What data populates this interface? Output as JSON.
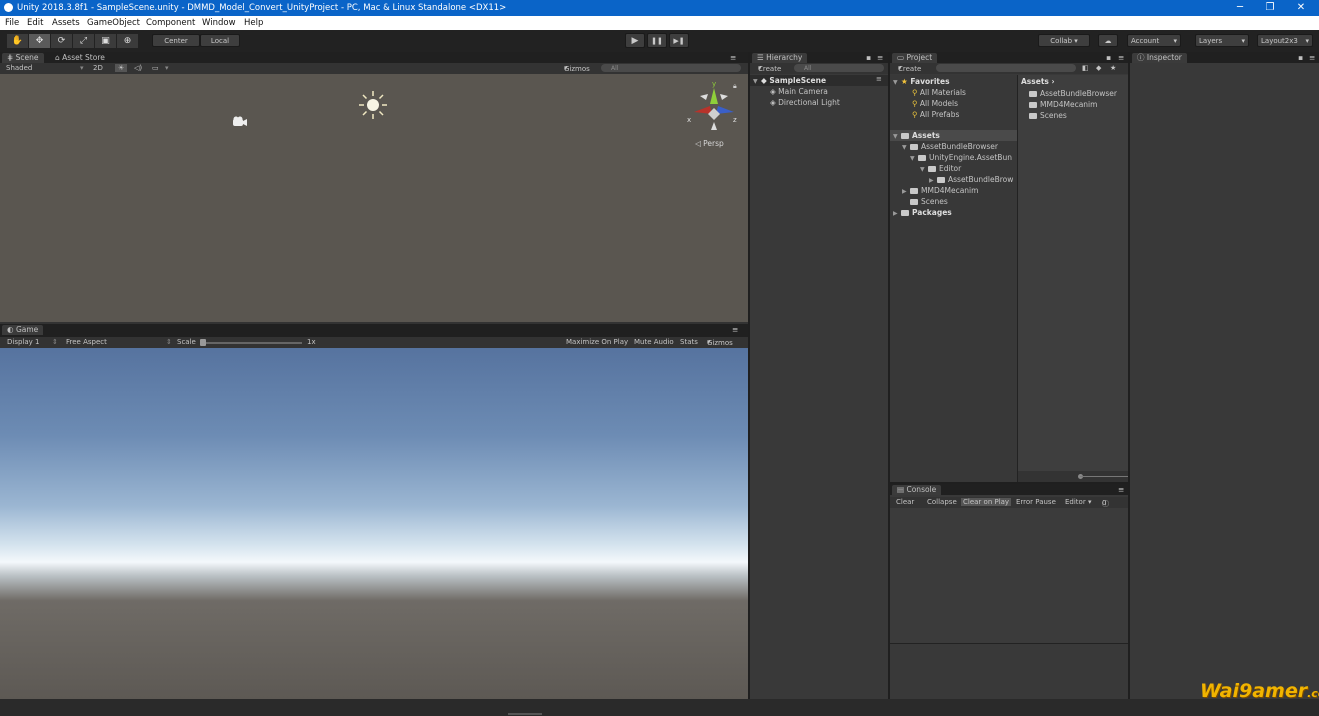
{
  "window": {
    "title": "Unity 2018.3.8f1 - SampleScene.unity - DMMD_Model_Convert_UnityProject - PC, Mac & Linux Standalone <DX11>",
    "controls": [
      "─",
      "❐",
      "✕"
    ]
  },
  "menu": [
    "File",
    "Edit",
    "Assets",
    "GameObject",
    "Component",
    "Window",
    "Help"
  ],
  "toolbar": {
    "tools": [
      "✋",
      "✥",
      "⟳",
      "⤢",
      "▣",
      "⊕"
    ],
    "pivot": "Center",
    "space": "Local",
    "play": "▶",
    "pause": "❚❚",
    "step": "▶❚",
    "collab": "Collab ▾",
    "cloud": "☁",
    "account": "Account",
    "layers": "Layers",
    "layout": "Layout2x3"
  },
  "scene": {
    "tabs": [
      "Scene",
      "Asset Store"
    ],
    "shading": "Shaded",
    "mode_2d": "2D",
    "gizmos": "Gizmos",
    "search_placeholder": "All",
    "persp": "Persp",
    "gizmo_axes": {
      "y": "y",
      "x": "x",
      "z": "z"
    }
  },
  "game": {
    "tab": "Game",
    "display": "Display 1",
    "aspect": "Free Aspect",
    "scale_label": "Scale",
    "scale_value": "1x",
    "maximize": "Maximize On Play",
    "mute": "Mute Audio",
    "stats": "Stats",
    "gizmos": "Gizmos"
  },
  "hierarchy": {
    "tab": "Hierarchy",
    "create": "Create",
    "search_placeholder": "All",
    "scene_name": "SampleScene",
    "items": [
      "Main Camera",
      "Directional Light"
    ]
  },
  "project": {
    "tab": "Project",
    "create": "Create",
    "favorites_header": "Favorites",
    "favorites": [
      "All Materials",
      "All Models",
      "All Prefabs"
    ],
    "assets_header": "Assets",
    "tree": {
      "assetbundlebrowser": "AssetBundleBrowser",
      "unityengine": "UnityEngine.AssetBun",
      "editor": "Editor",
      "assetbundlebrow": "AssetBundleBrow",
      "mmd": "MMD4Mecanim",
      "scenes": "Scenes",
      "packages": "Packages"
    },
    "breadcrumb": "Assets",
    "contents": [
      "AssetBundleBrowser",
      "MMD4Mecanim",
      "Scenes"
    ]
  },
  "console": {
    "tab": "Console",
    "buttons": [
      "Clear",
      "Collapse",
      "Clear on Play",
      "Error Pause",
      "Editor ▾"
    ],
    "error_count": "0"
  },
  "inspector": {
    "tab": "Inspector"
  },
  "watermark": {
    "brand": "Wai9amer",
    "suffix": ".com"
  },
  "colors": {
    "title_bar": "#0a64c8",
    "scene_bg": "#5a5650",
    "sky_top": "#5676a6",
    "horizon": "#f4f8fb",
    "ground": "#5d5954"
  }
}
